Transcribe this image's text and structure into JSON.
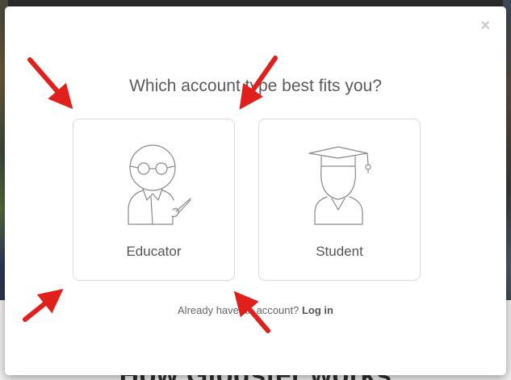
{
  "modal": {
    "title": "Which account type best fits you?",
    "close_label": "×",
    "cards": [
      {
        "label": "Educator",
        "icon": "educator-icon"
      },
      {
        "label": "Student",
        "icon": "student-icon"
      }
    ],
    "login_prompt": "Already have an account?",
    "login_link": "Log in"
  },
  "background": {
    "heading": "How Glogster works"
  },
  "annotation": {
    "arrow_color": "#e0201c"
  }
}
